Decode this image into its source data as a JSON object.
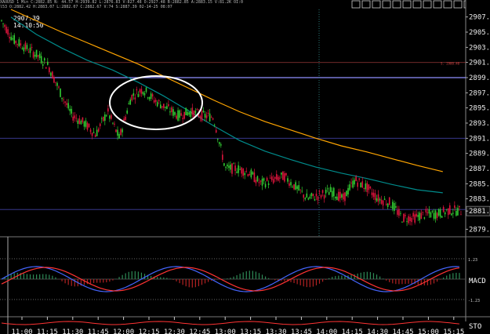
{
  "header": {
    "line1": "XAUUSD 1 Min  C:2882.85  N: 44.57  H:2939.82  L:2876.83  V:827.48  O:2927.48  B:2882.85  A:2883.15  V:81.2K  OI:0",
    "line2": "l53  O:2882.42  H:2883.07  L:2882.07  C:2882.67  V:74  S:2887.39  02-14-25  08:07",
    "crosshair_price": "2907.39",
    "crosshair_time": "14:10:50"
  },
  "toolbar": {
    "icons": [
      "eye-icon",
      "search-icon",
      "cursor-icon",
      "pointer-icon",
      "cross-icon",
      "hline-icon",
      "trend-icon",
      "grid-icon",
      "zoom-icon",
      "settings-icon",
      "list-icon",
      "window-icon",
      "close-icon"
    ]
  },
  "price_axis": {
    "ticks": [
      "2907.0",
      "2905.0",
      "2903.0",
      "2901.0",
      "2899.0",
      "2897.0",
      "2895.0",
      "2893.0",
      "2891.0",
      "2889.0",
      "2887.0",
      "2885.0",
      "2883.0",
      "2881.4",
      "2879.0"
    ],
    "current_price": "2881.4",
    "level_label": "S. 2900.40"
  },
  "time_axis": {
    "ticks": [
      "11:00",
      "11:15",
      "11:30",
      "11:45",
      "12:00",
      "12:15",
      "12:30",
      "12:45",
      "13:00",
      "13:15",
      "13:30",
      "13:45",
      "14:00",
      "14:15",
      "14:30",
      "14:45",
      "15:00",
      "15:15"
    ]
  },
  "indicators": {
    "macd_label": "MACD",
    "macd_upper": "1.23",
    "macd_lower": "-1.23",
    "sto_label": "STO"
  },
  "colors": {
    "background": "#000000",
    "up_candle": "#32cd32",
    "down_candle": "#dc143c",
    "ma_fast": "#008b8b",
    "ma_slow": "#ffa500",
    "h_line": "#6a6aff"
  },
  "chart_data": {
    "type": "candlestick",
    "symbol": "XAUUSD",
    "timeframe": "1 Min",
    "ylim": [
      2878.0,
      2908.0
    ],
    "x": [
      "11:00",
      "11:15",
      "11:30",
      "11:45",
      "12:00",
      "12:15",
      "12:30",
      "12:45",
      "13:00",
      "13:15",
      "13:30",
      "13:45",
      "14:00",
      "14:15",
      "14:30",
      "14:45",
      "15:00",
      "15:15"
    ],
    "close_path": [
      2906.5,
      2904,
      2903,
      2902,
      2900.5,
      2897,
      2894,
      2893,
      2891.5,
      2894.5,
      2891,
      2896.5,
      2897.5,
      2896,
      2895,
      2894,
      2894.5,
      2894,
      2893.8,
      2887,
      2887,
      2886.5,
      2885,
      2885.5,
      2886,
      2884.5,
      2883,
      2883.5,
      2884,
      2883,
      2885.5,
      2884.5,
      2883,
      2882.5,
      2880.5,
      2880.5,
      2881,
      2881,
      2881.5,
      2881.4
    ],
    "ma_fast": [
      2907.0,
      2904.7,
      2902.9,
      2901.3,
      2900.0,
      2898.4,
      2896.6,
      2894.6,
      2892.6,
      2890.7,
      2889.3,
      2888.2,
      2887.2,
      2886.4,
      2885.7,
      2884.9,
      2884.2,
      2883.8
    ],
    "ma_slow": [
      2908.0,
      2906.5,
      2905.0,
      2903.6,
      2902.2,
      2900.8,
      2899.2,
      2897.6,
      2896.0,
      2894.5,
      2893.2,
      2892.1,
      2891.0,
      2890.0,
      2889.2,
      2888.3,
      2887.4,
      2886.6
    ],
    "h_lines": [
      2901.0,
      2899.0,
      2891.0,
      2881.6
    ],
    "annotation": "ellipse around 12:00–12:30 consolidation"
  }
}
